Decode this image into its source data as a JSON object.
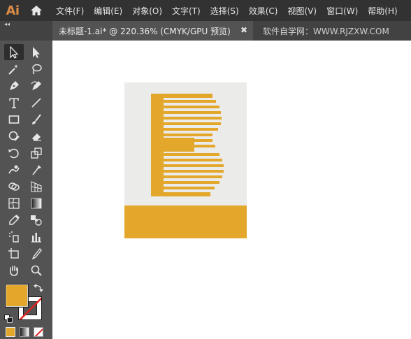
{
  "app": {
    "logo": "Ai"
  },
  "menu": [
    "文件(F)",
    "编辑(E)",
    "对象(O)",
    "文字(T)",
    "选择(S)",
    "效果(C)",
    "视图(V)",
    "窗口(W)",
    "帮助(H)"
  ],
  "tabs": {
    "collapse": "◂◂",
    "active": "未标题-1.ai* @ 220.36% (CMYK/GPU 预览)",
    "close": "✖",
    "other": "软件自学网：WWW.RJZXW.COM"
  },
  "colors": {
    "fill": "#e3a82b",
    "artboard": "#ebebe9",
    "ui_dark": "#323232",
    "ui_panel": "#535353"
  },
  "tools": [
    "selection-tool",
    "direct-selection-tool",
    "magic-wand-tool",
    "lasso-tool",
    "pen-tool",
    "curvature-tool",
    "type-tool",
    "line-segment-tool",
    "rectangle-tool",
    "paintbrush-tool",
    "shaper-tool",
    "eraser-tool",
    "rotate-tool",
    "scale-tool",
    "warp-tool",
    "puppet-warp-tool",
    "shape-builder-tool",
    "perspective-grid-tool",
    "mesh-tool",
    "gradient-tool",
    "eyedropper-tool",
    "blend-tool",
    "symbol-sprayer-tool",
    "column-graph-tool",
    "artboard-tool",
    "slice-tool",
    "hand-tool",
    "zoom-tool"
  ]
}
